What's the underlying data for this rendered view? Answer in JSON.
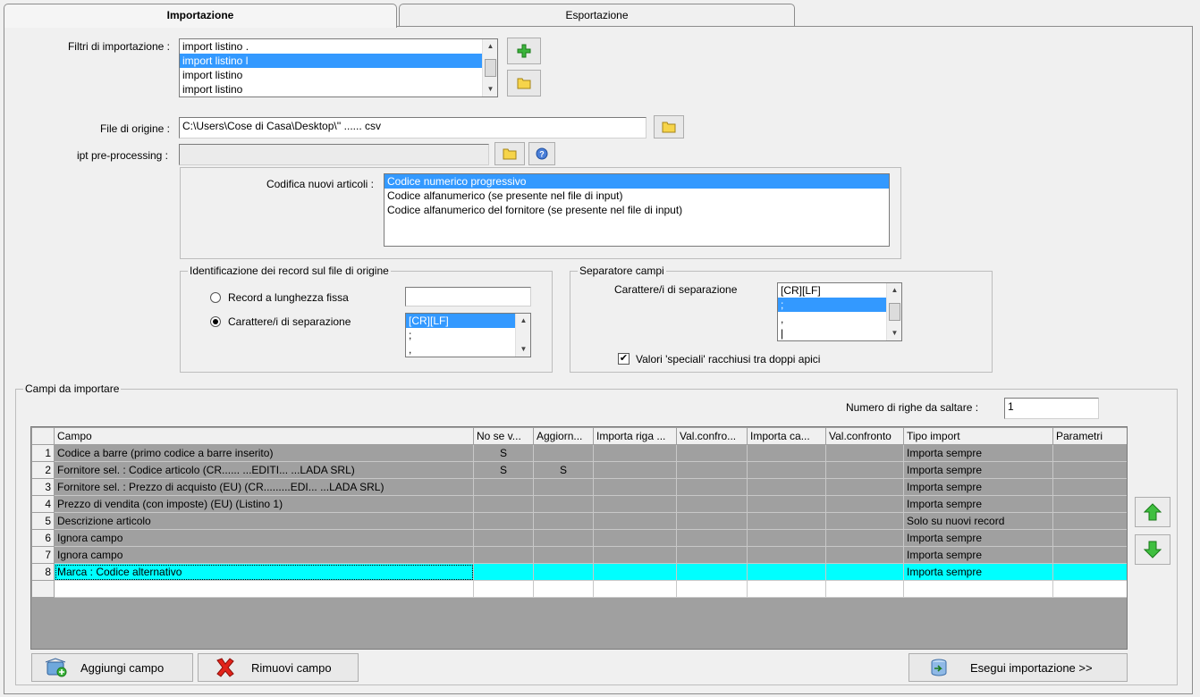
{
  "tabs": [
    {
      "label": "Importazione",
      "active": true
    },
    {
      "label": "Esportazione",
      "active": false
    }
  ],
  "filters": {
    "label": "Filtri di importazione :",
    "items": [
      "import listino .",
      "import listino l",
      "import listino",
      "import listino"
    ],
    "selected_index": 1
  },
  "origin_file": {
    "label": "File di origine :",
    "value": "C:\\Users\\Cose di Casa\\Desktop\\'' ...... csv"
  },
  "preprocessing": {
    "label": "ipt pre-processing :",
    "value": ""
  },
  "encoding": {
    "label": "Codifica nuovi articoli :",
    "options": [
      "Codice numerico progressivo",
      "Codice alfanumerico (se presente nel file di input)",
      "Codice alfanumerico del fornitore (se presente nel file di input)"
    ],
    "selected_index": 0
  },
  "record_ident": {
    "title": "Identificazione dei record sul file di origine",
    "fixed_label": "Record a lunghezza fissa",
    "fixed_value": "",
    "sep_label": "Carattere/i di separazione",
    "sep_selected": true,
    "sep_items": [
      "[CR][LF]",
      ";",
      ","
    ],
    "sep_selected_index": 0
  },
  "field_sep": {
    "title": "Separatore campi",
    "label": "Carattere/i di separazione",
    "items": [
      "[CR][LF]",
      ";",
      ",",
      "|"
    ],
    "selected_index": 1,
    "quoted_label": "Valori 'speciali' racchiusi tra doppi apici",
    "quoted_checked": true
  },
  "fields": {
    "title": "Campi da importare",
    "skip_label": "Numero di righe da saltare :",
    "skip_value": "1",
    "columns": [
      "Campo",
      "No se v...",
      "Aggiorn...",
      "Importa riga ...",
      "Val.confro...",
      "Importa ca...",
      "Val.confronto",
      "Tipo import",
      "Parametri"
    ],
    "rows": [
      {
        "n": "1",
        "campo": "Codice a barre (primo codice a barre inserito)",
        "nosev": "S",
        "aggiorn": "",
        "tipo": "Importa sempre"
      },
      {
        "n": "2",
        "campo": "Fornitore sel. : Codice articolo (CR...... ...EDITI... ...LADA SRL)",
        "nosev": "S",
        "aggiorn": "S",
        "tipo": "Importa sempre"
      },
      {
        "n": "3",
        "campo": "Fornitore sel. : Prezzo di acquisto (EU) (CR.........EDI... ...LADA SRL)",
        "nosev": "",
        "aggiorn": "",
        "tipo": "Importa sempre"
      },
      {
        "n": "4",
        "campo": "Prezzo di vendita (con imposte) (EU) (Listino 1)",
        "nosev": "",
        "aggiorn": "",
        "tipo": "Importa sempre"
      },
      {
        "n": "5",
        "campo": "Descrizione articolo",
        "nosev": "",
        "aggiorn": "",
        "tipo": "Solo su nuovi record"
      },
      {
        "n": "6",
        "campo": "Ignora campo",
        "nosev": "",
        "aggiorn": "",
        "tipo": "Importa sempre"
      },
      {
        "n": "7",
        "campo": "Ignora campo",
        "nosev": "",
        "aggiorn": "",
        "tipo": "Importa sempre"
      },
      {
        "n": "8",
        "campo": "Marca : Codice alternativo",
        "nosev": "",
        "aggiorn": "",
        "tipo": "Importa sempre"
      }
    ],
    "highlight_index": 7
  },
  "buttons": {
    "add": "Aggiungi campo",
    "remove": "Rimuovi campo",
    "run": "Esegui importazione >>"
  },
  "colors": {
    "selection": "#3399ff",
    "row_highlight": "#00ffff",
    "grid_empty": "#a0a0a0"
  }
}
